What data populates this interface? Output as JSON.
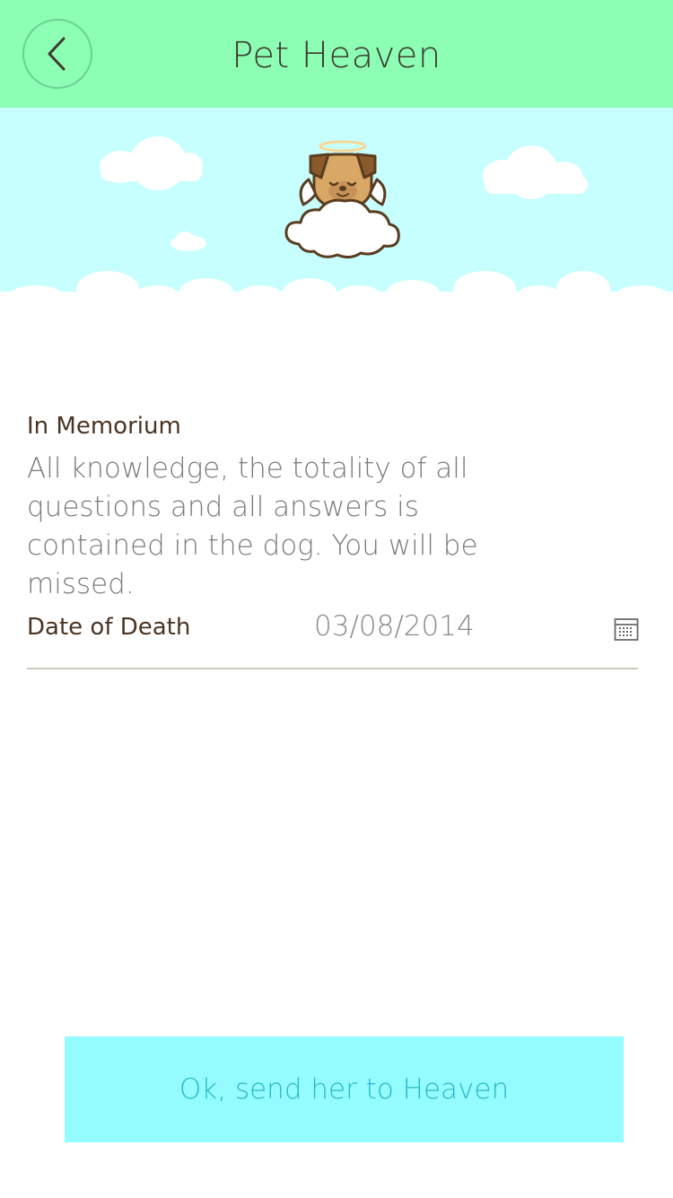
{
  "header": {
    "title": "Pet Heaven"
  },
  "memorium": {
    "label": "In Memorium",
    "text": "All knowledge, the totality of all questions and all answers is contained in the dog. You will be missed."
  },
  "date_of_death": {
    "label": "Date of Death",
    "value": "03/08/2014"
  },
  "actions": {
    "send_label": "Ok, send her to Heaven"
  },
  "colors": {
    "header_bg": "#8cffb5",
    "banner_bg": "#c6fffd",
    "button_bg": "#94fbfe",
    "button_text": "#2bb9c7"
  },
  "icons": [
    "back-arrow-icon",
    "angel-dog-icon",
    "calendar-icon"
  ]
}
